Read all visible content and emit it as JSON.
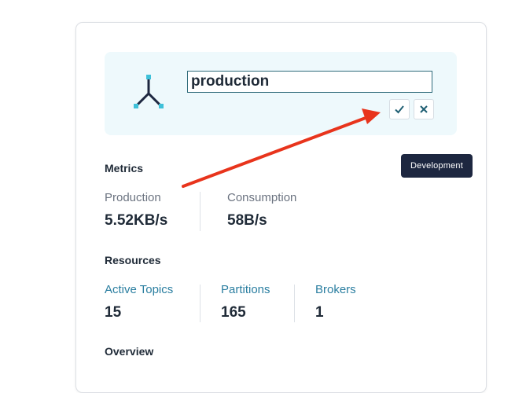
{
  "cluster": {
    "name_value": "production",
    "tooltip": "Development",
    "icon": "cluster-icon"
  },
  "metrics": {
    "title": "Metrics",
    "production_label": "Production",
    "production_value": "5.52KB/s",
    "consumption_label": "Consumption",
    "consumption_value": "58B/s"
  },
  "resources": {
    "title": "Resources",
    "topics_label": "Active Topics",
    "topics_value": "15",
    "partitions_label": "Partitions",
    "partitions_value": "165",
    "brokers_label": "Brokers",
    "brokers_value": "1"
  },
  "overview": {
    "title": "Overview"
  },
  "colors": {
    "accent": "#2a7ea0",
    "arrow": "#e8341c",
    "tooltip_bg": "#1d2740",
    "panel_bg": "#eef9fc"
  }
}
